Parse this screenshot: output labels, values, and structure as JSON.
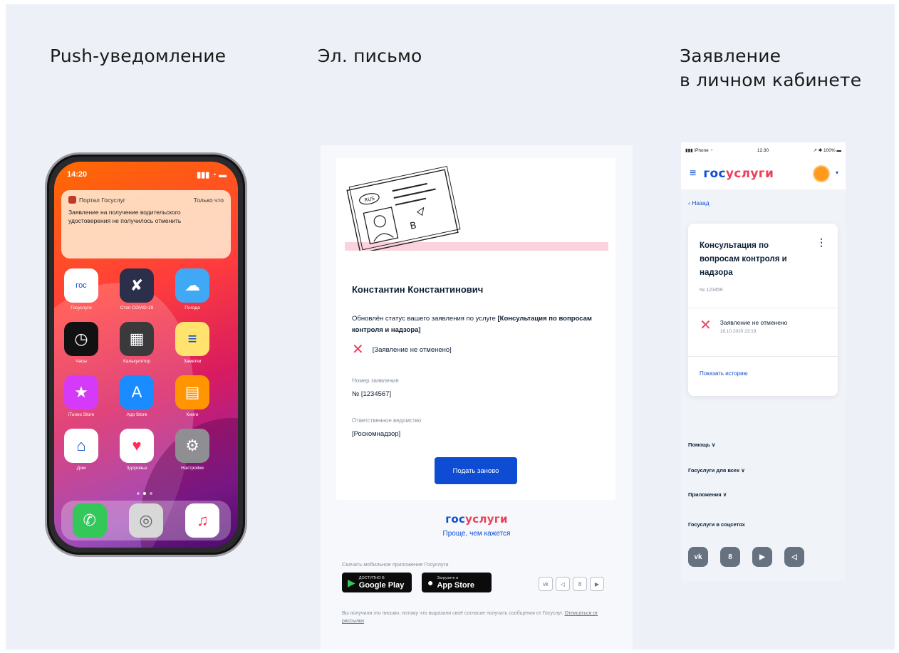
{
  "headings": {
    "push": "Push-уведомление",
    "email": "Эл. письмо",
    "cabinet_line1": "Заявление",
    "cabinet_line2": "в личном кабинете"
  },
  "phone": {
    "time": "14:20",
    "signal": "▮▮▮ ◔ ▬",
    "notification": {
      "app": "Портал Госуслуг",
      "when": "Только что",
      "body": "Заявление на получение водительского удостоверения не получилось отменить"
    },
    "apps": [
      {
        "name": "gosuslugi",
        "label": "Госуслуги",
        "bg": "#ffffff",
        "glyph": "гос"
      },
      {
        "name": "covid",
        "label": "Стоп COVID-19",
        "bg": "#2b2f4a",
        "glyph": "✘"
      },
      {
        "name": "weather",
        "label": "Погода",
        "bg": "#3fa9f5",
        "glyph": "☁"
      },
      {
        "name": "clock",
        "label": "Часы",
        "bg": "#111111",
        "glyph": "◷"
      },
      {
        "name": "calculator",
        "label": "Калькулятор",
        "bg": "#3a3a3c",
        "glyph": "▦"
      },
      {
        "name": "notes",
        "label": "Заметки",
        "bg": "#ffe36e",
        "glyph": "≡"
      },
      {
        "name": "itunes",
        "label": "iTunes Store",
        "bg": "#d63af9",
        "glyph": "★"
      },
      {
        "name": "app-store",
        "label": "App Store",
        "bg": "#1a8cff",
        "glyph": "A"
      },
      {
        "name": "books",
        "label": "Книги",
        "bg": "#ff9500",
        "glyph": "▤"
      },
      {
        "name": "home",
        "label": "Дом",
        "bg": "#ffffff",
        "glyph": "⌂"
      },
      {
        "name": "health",
        "label": "Здоровье",
        "bg": "#ffffff",
        "glyph": "♥"
      },
      {
        "name": "settings",
        "label": "Настройки",
        "bg": "#8e8e93",
        "glyph": "⚙"
      }
    ],
    "dock": [
      {
        "name": "phone",
        "bg": "#34c759",
        "glyph": "✆"
      },
      {
        "name": "safari",
        "bg": "#d8d8d8",
        "glyph": "◎"
      },
      {
        "name": "music",
        "bg": "#ffffff",
        "glyph": "♫"
      }
    ]
  },
  "email": {
    "badge_text": "RUS",
    "card_letter": "B",
    "recipient_name": "Константин Константинович",
    "status_text_prefix": "Обновлён статус вашего заявления по услуге ",
    "status_text_service": "[Консультация по вопросам контроля и надзора]",
    "status_value": "[Заявление не отменено]",
    "application_number_label": "Номер заявления",
    "application_number": "№ [1234567]",
    "department_label": "Ответственное ведомство",
    "department": "[Роскомнадзор]",
    "submit_button": "Подать заново",
    "brand_part1": "гос",
    "brand_part2": "услуги",
    "slogan": "Проще, чем кажется",
    "download_text": "Скачать мобильное приложение Госуслуги",
    "google_play_small": "ДОСТУПНО В",
    "google_play_big": "Google Play",
    "app_store_small": "Загрузите в",
    "app_store_big": "App Store",
    "footer_text": "Вы получили это письмо, потому что выразили своё согласие получать сообщения от Госуслуг. ",
    "unsubscribe_link": "Отписаться от рассылки",
    "social": [
      "vk",
      "tg",
      "ok",
      "yt"
    ],
    "social_glyphs": [
      "vk",
      "◁",
      "8",
      "▶"
    ]
  },
  "cabinet": {
    "status_carrier": "▮▮▮ iPhone ◔",
    "status_time": "12:30",
    "status_battery": "↗ ✱ 100% ▬",
    "brand_part1": "гос",
    "brand_part2": "услуги",
    "back_link": "‹ Назад",
    "application_title": "Консультация по вопросам контроля и надзора",
    "application_number": "№ 123456",
    "status_text": "Заявление не отменено",
    "status_date": "18.10.2020 23:19",
    "show_history": "Показать историю",
    "footer_links": [
      "Помощь ∨",
      "Госуслуги для всех ∨",
      "Приложения ∨",
      "Госуслуги в соцсетях"
    ],
    "social_glyphs": [
      "vk",
      "8",
      "▶",
      "◁"
    ]
  },
  "colors": {
    "brand_blue": "#0d4cd3",
    "brand_red": "#ee3f58",
    "background": "#edf1f7"
  }
}
